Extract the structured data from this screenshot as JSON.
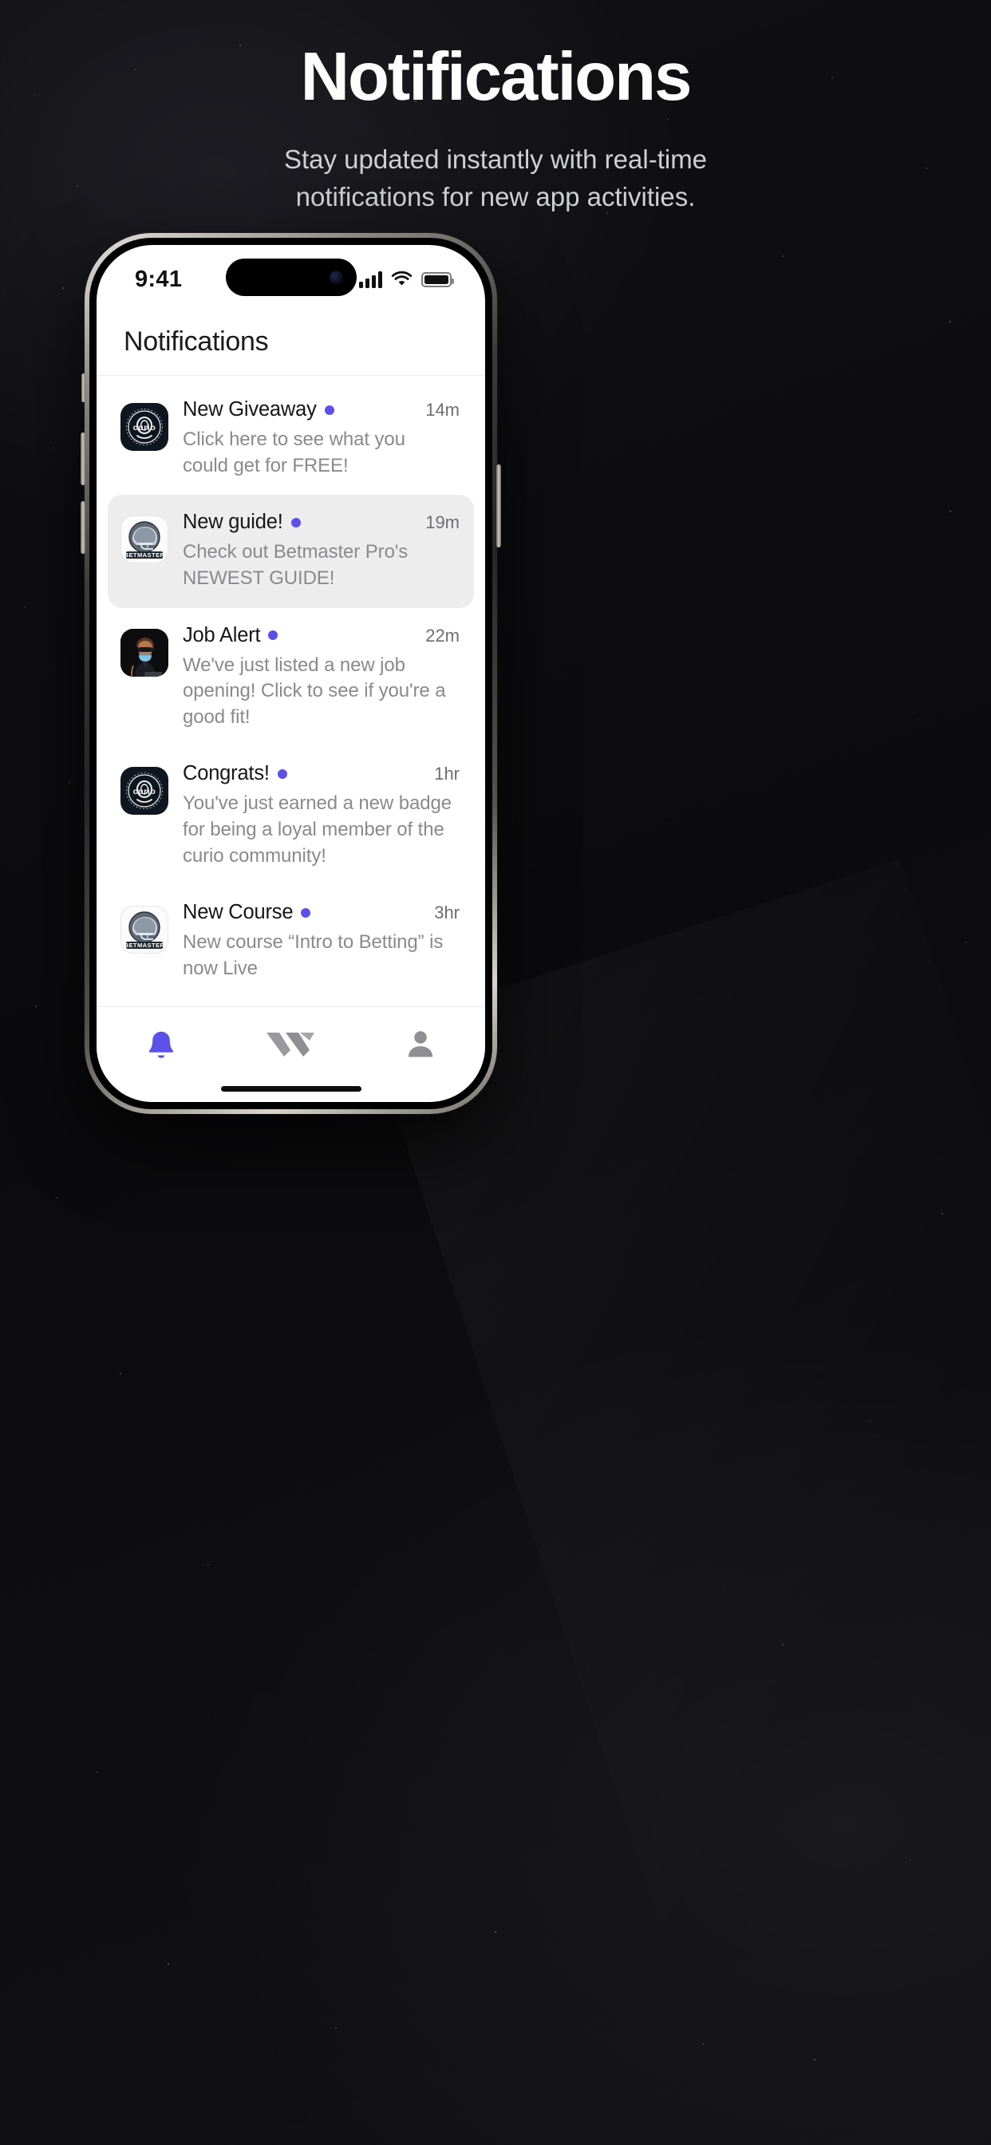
{
  "hero": {
    "title": "Notifications",
    "subtitle_line1": "Stay updated instantly with real-time",
    "subtitle_line2": "notifications for new app activities."
  },
  "colors": {
    "accent": "#5B50E8",
    "page_bg": "#0c0c0e",
    "screen_bg": "#ffffff",
    "row_active_bg": "#ededee",
    "title_text": "#161616",
    "body_text": "#8a8a8d",
    "time_text": "#6e6e72",
    "tab_inactive": "#8e8e93"
  },
  "status_bar": {
    "time": "9:41",
    "cellular_icon": "signal-bars-icon",
    "wifi_icon": "wifi-icon",
    "battery_icon": "battery-icon"
  },
  "app": {
    "header_title": "Notifications"
  },
  "notifications": [
    {
      "title": "New Giveaway",
      "message": "Click here to see what you could get for FREE!",
      "time": "14m",
      "unread": true,
      "avatar": "curio-logo-avatar",
      "avatar_style": "dark",
      "highlighted": false
    },
    {
      "title": "New guide!",
      "message": "Check out Betmaster Pro's NEWEST GUIDE!",
      "time": "19m",
      "unread": true,
      "avatar": "betmaster-helmet-avatar",
      "avatar_style": "light",
      "highlighted": true
    },
    {
      "title": "Job Alert",
      "message": "We've just listed a new job opening! Click to see if you're a good fit!",
      "time": "22m",
      "unread": true,
      "avatar": "person-illustration-avatar",
      "avatar_style": "dark",
      "highlighted": false
    },
    {
      "title": "Congrats!",
      "message": "You've just earned a new badge for being a loyal member of the curio community!",
      "time": "1hr",
      "unread": true,
      "avatar": "curio-logo-avatar",
      "avatar_style": "dark",
      "highlighted": false
    },
    {
      "title": "New Course",
      "message": "New course “Intro to Betting” is now Live",
      "time": "3hr",
      "unread": true,
      "avatar": "betmaster-helmet-avatar",
      "avatar_style": "light",
      "highlighted": false
    }
  ],
  "tabbar": {
    "items": [
      {
        "icon": "bell-icon",
        "active": true
      },
      {
        "icon": "chevrons-logo-icon",
        "active": false
      },
      {
        "icon": "person-icon",
        "active": false
      }
    ]
  }
}
